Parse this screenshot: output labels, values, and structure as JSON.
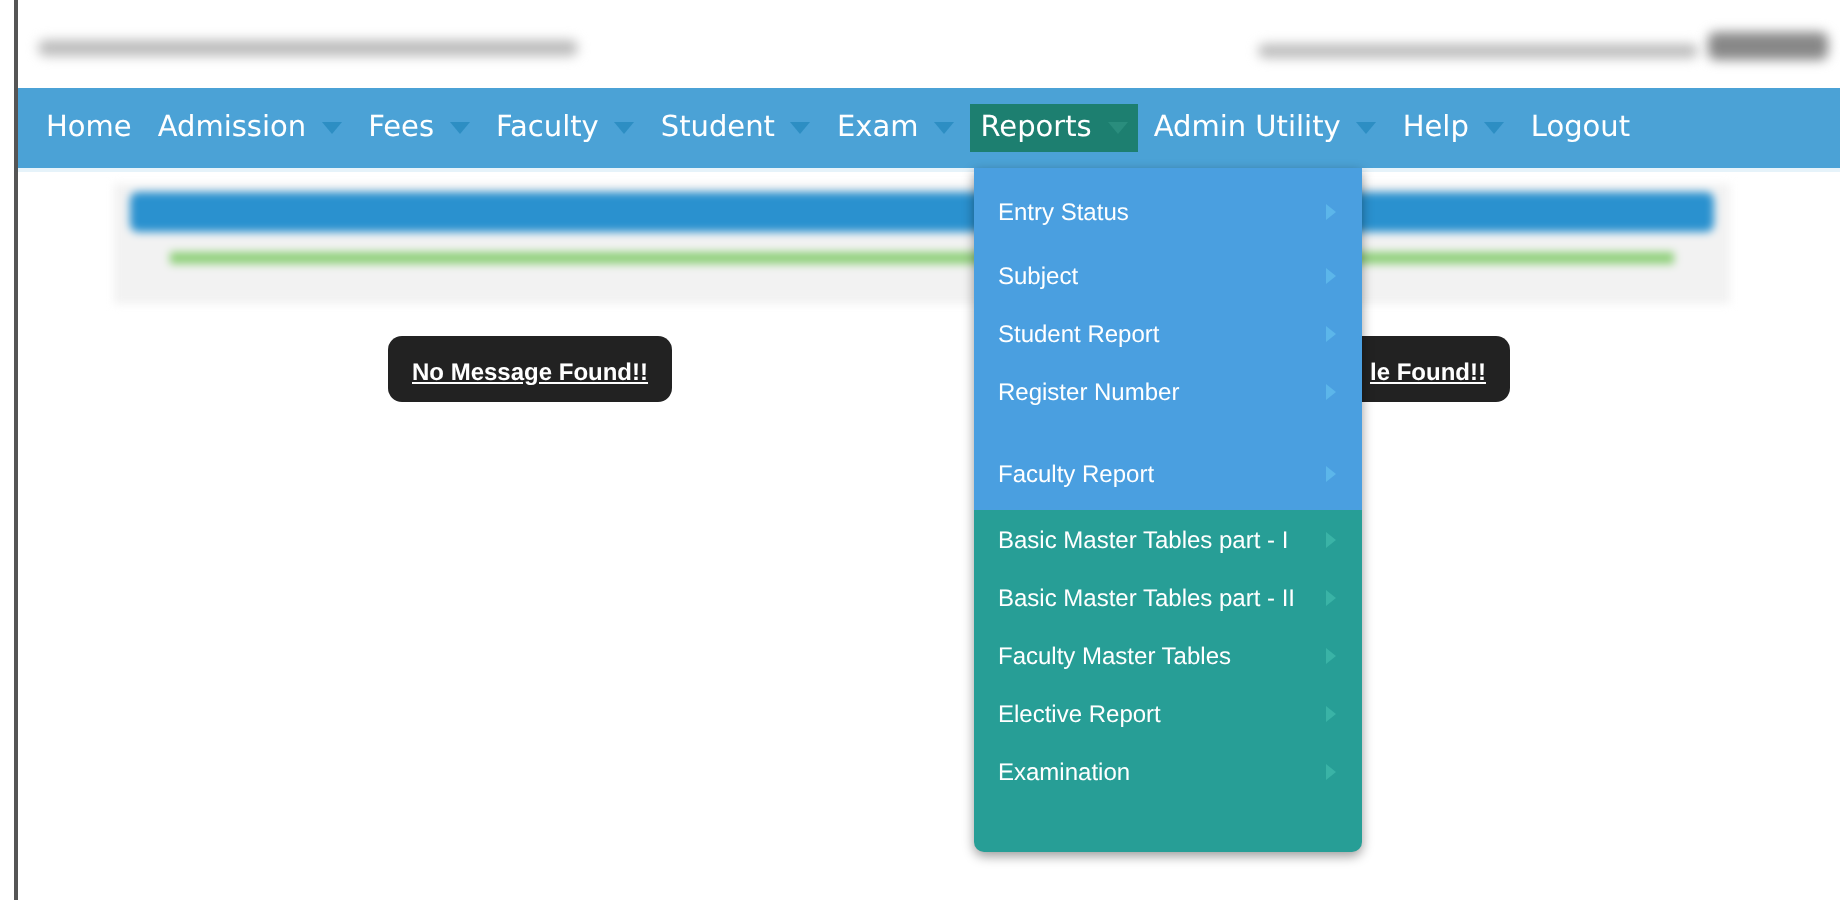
{
  "nav": [
    {
      "label": "Home",
      "has_dropdown": false,
      "selected": false
    },
    {
      "label": "Admission",
      "has_dropdown": true,
      "selected": false
    },
    {
      "label": "Fees",
      "has_dropdown": true,
      "selected": false
    },
    {
      "label": "Faculty",
      "has_dropdown": true,
      "selected": false
    },
    {
      "label": "Student",
      "has_dropdown": true,
      "selected": false
    },
    {
      "label": "Exam",
      "has_dropdown": true,
      "selected": false
    },
    {
      "label": "Reports",
      "has_dropdown": true,
      "selected": true
    },
    {
      "label": "Admin Utility",
      "has_dropdown": true,
      "selected": false
    },
    {
      "label": "Help",
      "has_dropdown": true,
      "selected": false
    },
    {
      "label": "Logout",
      "has_dropdown": false,
      "selected": false
    }
  ],
  "menu": [
    {
      "label": "Entry Status",
      "highlighted": true
    },
    {
      "label": "Subject",
      "highlighted": true
    },
    {
      "label": "Student Report",
      "highlighted": true
    },
    {
      "label": "Register Number",
      "highlighted": true
    },
    {
      "label": "Faculty Report",
      "highlighted": true
    },
    {
      "label": "Basic Master Tables part - I",
      "highlighted": false
    },
    {
      "label": "Basic Master Tables part - II",
      "highlighted": false
    },
    {
      "label": "Faculty Master Tables",
      "highlighted": false
    },
    {
      "label": "Elective Report",
      "highlighted": false
    },
    {
      "label": "Examination",
      "highlighted": false
    }
  ],
  "messages": [
    "No Message Found!!",
    "le Found!!"
  ]
}
